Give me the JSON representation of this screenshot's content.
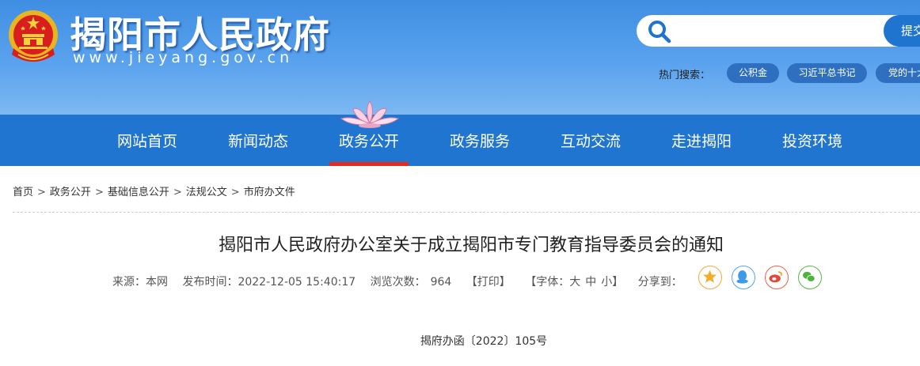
{
  "header": {
    "site_title": "揭阳市人民政府",
    "site_url": "www.jieyang.gov.cn",
    "search": {
      "placeholder": "",
      "button_label": "提交"
    },
    "hot_search": {
      "label": "热门搜索：",
      "tags": [
        "公积金",
        "习近平总书记",
        "党的十大"
      ]
    }
  },
  "nav": {
    "items": [
      "网站首页",
      "新闻动态",
      "政务公开",
      "政务服务",
      "互动交流",
      "走进揭阳",
      "投资环境"
    ],
    "active_index": 2
  },
  "breadcrumb": [
    "首页",
    "政务公开",
    "基础信息公开",
    "法规公文",
    "市府办文件"
  ],
  "breadcrumb_separator": ">",
  "article": {
    "title": "揭阳市人民政府办公室关于成立揭阳市专门教育指导委员会的通知",
    "source": "来源：本网",
    "publish_time": "发布时间：2022-12-05 15:40:17",
    "views_label": "浏览次数：",
    "views": "964",
    "print": "【打印】",
    "font_size": {
      "prefix": "【字体：",
      "large": "大",
      "medium": "中",
      "small": "小",
      "suffix": "】"
    },
    "share_label": "分享到：",
    "share_icons": [
      "qzone-icon",
      "qq-icon",
      "weibo-icon",
      "wechat-icon"
    ],
    "doc_number": "揭府办函〔2022〕105号"
  },
  "colors": {
    "header_blue": "#4a97e8",
    "nav_blue": "#1f75cf",
    "active_underline": "#e52a20",
    "tag_blue": "#2f6fbf"
  }
}
